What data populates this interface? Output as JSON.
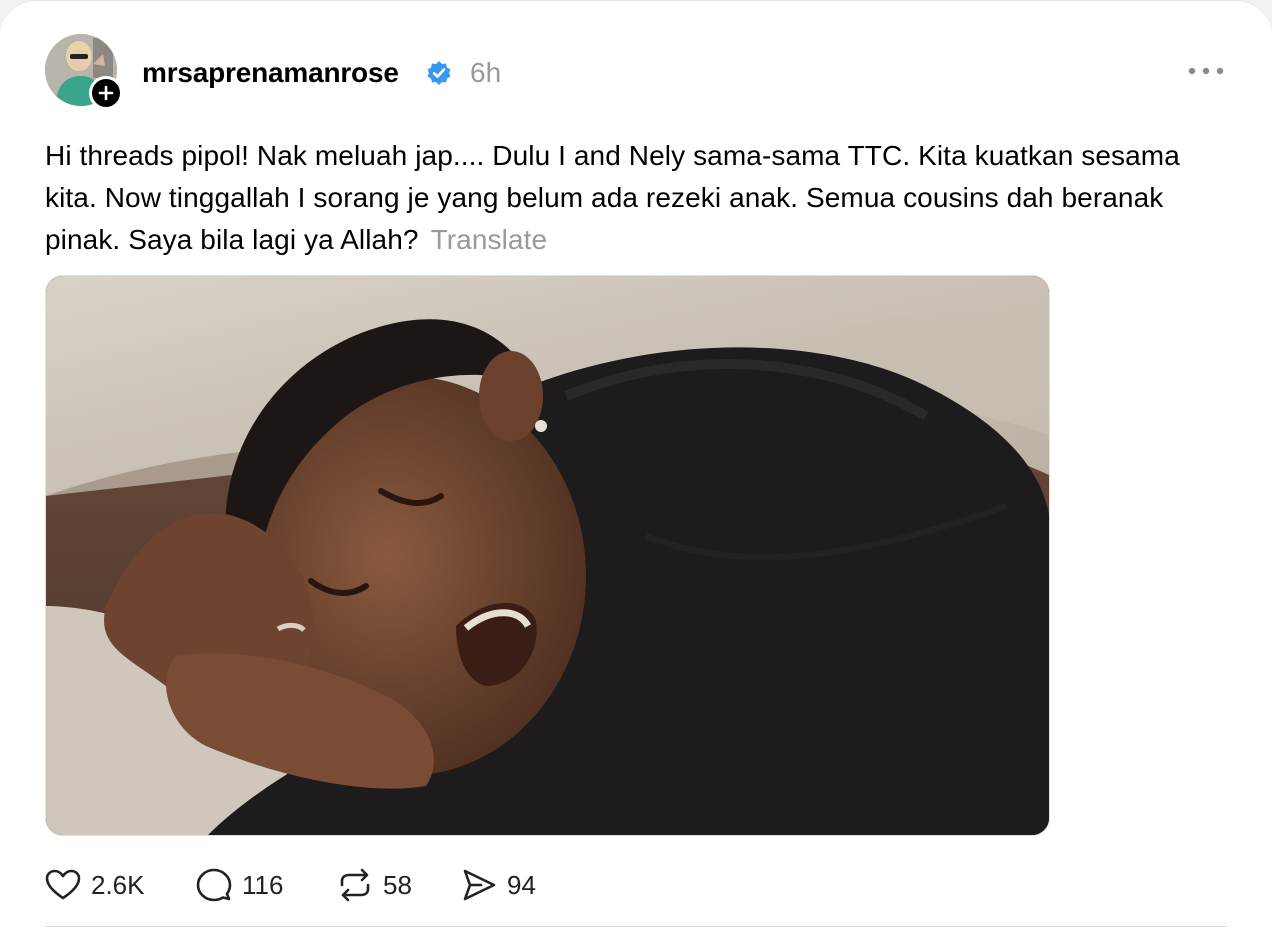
{
  "post": {
    "username": "mrsaprenamanrose",
    "timestamp": "6h",
    "text": "Hi threads pipol! Nak meluah jap.... Dulu I and Nely sama-sama TTC. Kita kuatkan sesama kita. Now tinggallah I sorang je yang belum ada rezeki anak. Semua cousins dah beranak pinak. Saya bila lagi ya Allah?",
    "translate_label": "Translate"
  },
  "actions": {
    "likes": "2.6K",
    "replies": "116",
    "reposts": "58",
    "shares": "94"
  },
  "colors": {
    "verified": "#3897f0",
    "muted_text": "#999999"
  },
  "icons": [
    "plus-icon",
    "verified-badge-icon",
    "more-options-icon",
    "heart-icon",
    "comment-icon",
    "repost-icon",
    "share-icon"
  ]
}
